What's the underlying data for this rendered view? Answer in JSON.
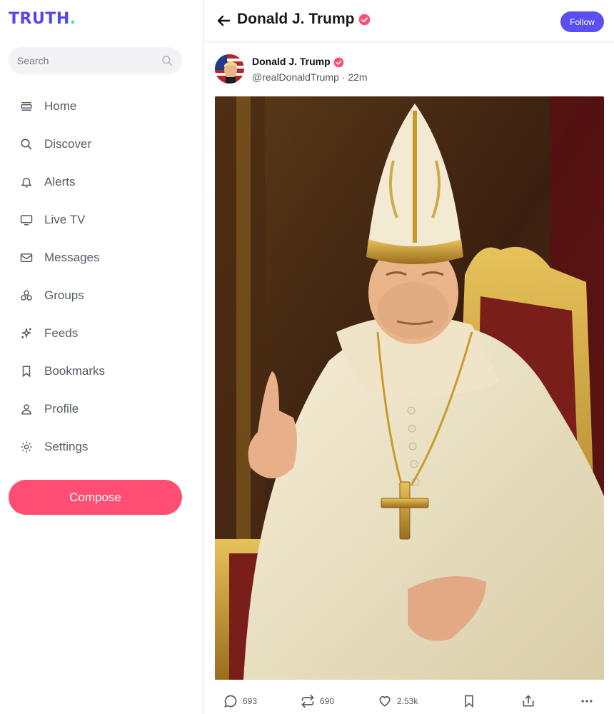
{
  "brand": {
    "logo_text": "TRUTH",
    "logo_dot": ".",
    "color": "#5448ee",
    "dot_color": "#2ee6c6"
  },
  "search": {
    "placeholder": "Search",
    "icon": "search-icon"
  },
  "nav": {
    "items": [
      {
        "label": "Home",
        "icon": "home-icon"
      },
      {
        "label": "Discover",
        "icon": "search-icon"
      },
      {
        "label": "Alerts",
        "icon": "bell-icon"
      },
      {
        "label": "Live TV",
        "icon": "tv-icon"
      },
      {
        "label": "Messages",
        "icon": "mail-icon"
      },
      {
        "label": "Groups",
        "icon": "groups-icon"
      },
      {
        "label": "Feeds",
        "icon": "sparkle-icon"
      },
      {
        "label": "Bookmarks",
        "icon": "bookmark-icon"
      },
      {
        "label": "Profile",
        "icon": "user-icon"
      },
      {
        "label": "Settings",
        "icon": "gear-icon"
      }
    ]
  },
  "compose": {
    "label": "Compose",
    "color": "#ff4d74"
  },
  "header": {
    "title": "Donald J. Trump",
    "follow_label": "Follow",
    "follow_color": "#5a4ff0"
  },
  "post": {
    "author": "Donald J. Trump",
    "handle": "@realDonaldTrump",
    "separator": "·",
    "time": "22m",
    "verified_color": "#ff4d74",
    "image": "papal-portrait-image"
  },
  "actions": {
    "replies": "693",
    "reblogs": "690",
    "likes": "2.53k"
  }
}
